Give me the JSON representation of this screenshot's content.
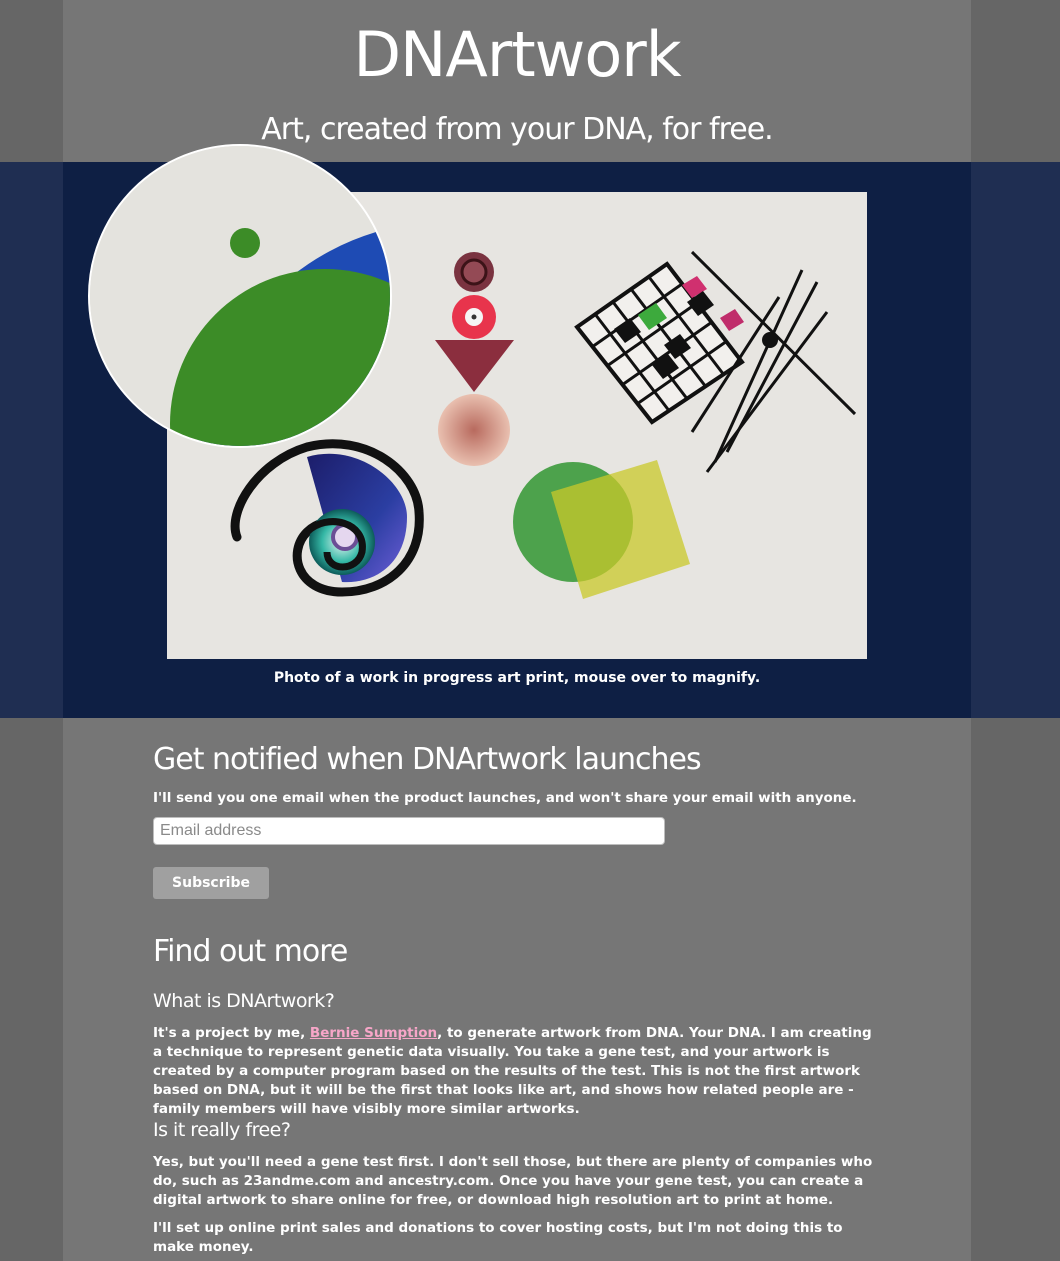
{
  "header": {
    "title": "DNArtwork",
    "tagline": "Art, created from your DNA, for free."
  },
  "hero": {
    "caption": "Photo of a work in progress art print, mouse over to magnify."
  },
  "notify": {
    "heading": "Get notified when DNArtwork launches",
    "text": "I'll send you one email when the product launches, and won't share your email with anyone.",
    "email_placeholder": "Email address",
    "subscribe_label": "Subscribe"
  },
  "more": {
    "heading": "Find out more",
    "q1": "What is DNArtwork?",
    "a1_pre": "It's a project by me, ",
    "a1_link": "Bernie Sumption",
    "a1_post": ", to generate artwork from DNA. Your DNA. I am creating a technique to represent genetic data visually. You take a gene test, and your artwork is created by a computer program based on the results of the test. This is not the first artwork based on DNA, but it will be the first that looks like art, and shows how related people are - family members will have visibly more similar artworks.",
    "q2": "Is it really free?",
    "a2": "Yes, but you'll need a gene test first. I don't sell those, but there are plenty of companies who do, such as 23andme.com and ancestry.com. Once you have your gene test, you can create a digital artwork to share online for free, or download high resolution art to print at home.",
    "a2b": "I'll set up online print sales and donations to cover hosting costs, but I'm not doing this to make money."
  },
  "colors": {
    "page_bg": "#666666",
    "column_bg": "#767676",
    "hero_band": "#1f2e52",
    "hero_inner": "#0e1f44",
    "link": "#f7a6c8"
  }
}
